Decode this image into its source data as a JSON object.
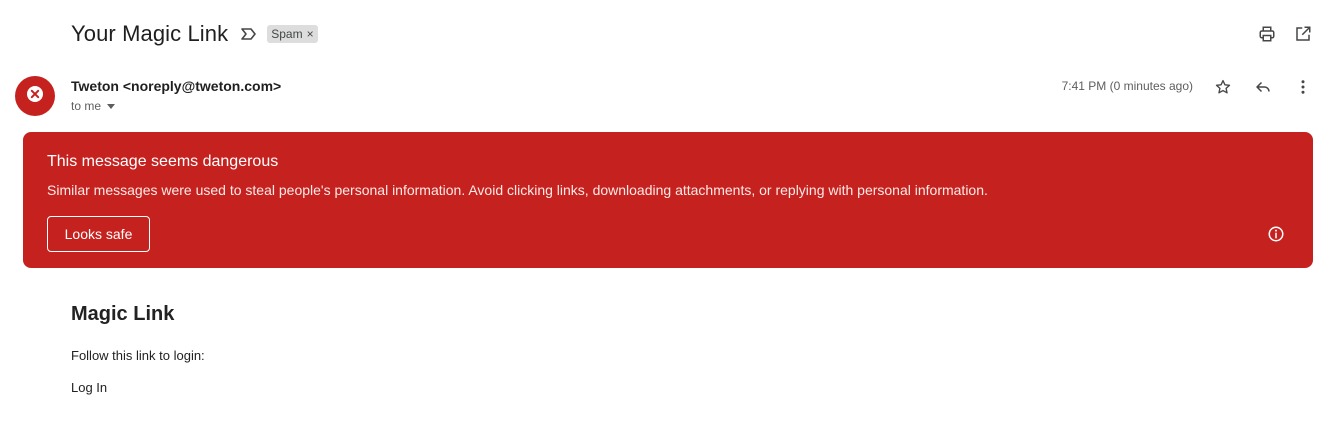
{
  "email": {
    "subject": "Your Magic Link",
    "label_chip": "Spam",
    "label_remove_glyph": "×",
    "sender": "Tweton <noreply@tweton.com>",
    "recipient_summary": "to me",
    "timestamp": "7:41 PM (0 minutes ago)"
  },
  "warning": {
    "title": "This message seems dangerous",
    "text": "Similar messages were used to steal people's personal information. Avoid clicking links, downloading attachments, or replying with personal information.",
    "button_label": "Looks safe",
    "color": "#c5221f"
  },
  "body": {
    "heading": "Magic Link",
    "text": "Follow this link to login:",
    "link_text": "Log In"
  },
  "icons": {
    "important": "important-marker-icon",
    "print": "print-icon",
    "open_new_window": "open-in-new-window-icon",
    "avatar": "danger-x-icon",
    "star": "star-icon",
    "reply": "reply-icon",
    "more": "more-vert-icon",
    "info": "info-icon"
  }
}
